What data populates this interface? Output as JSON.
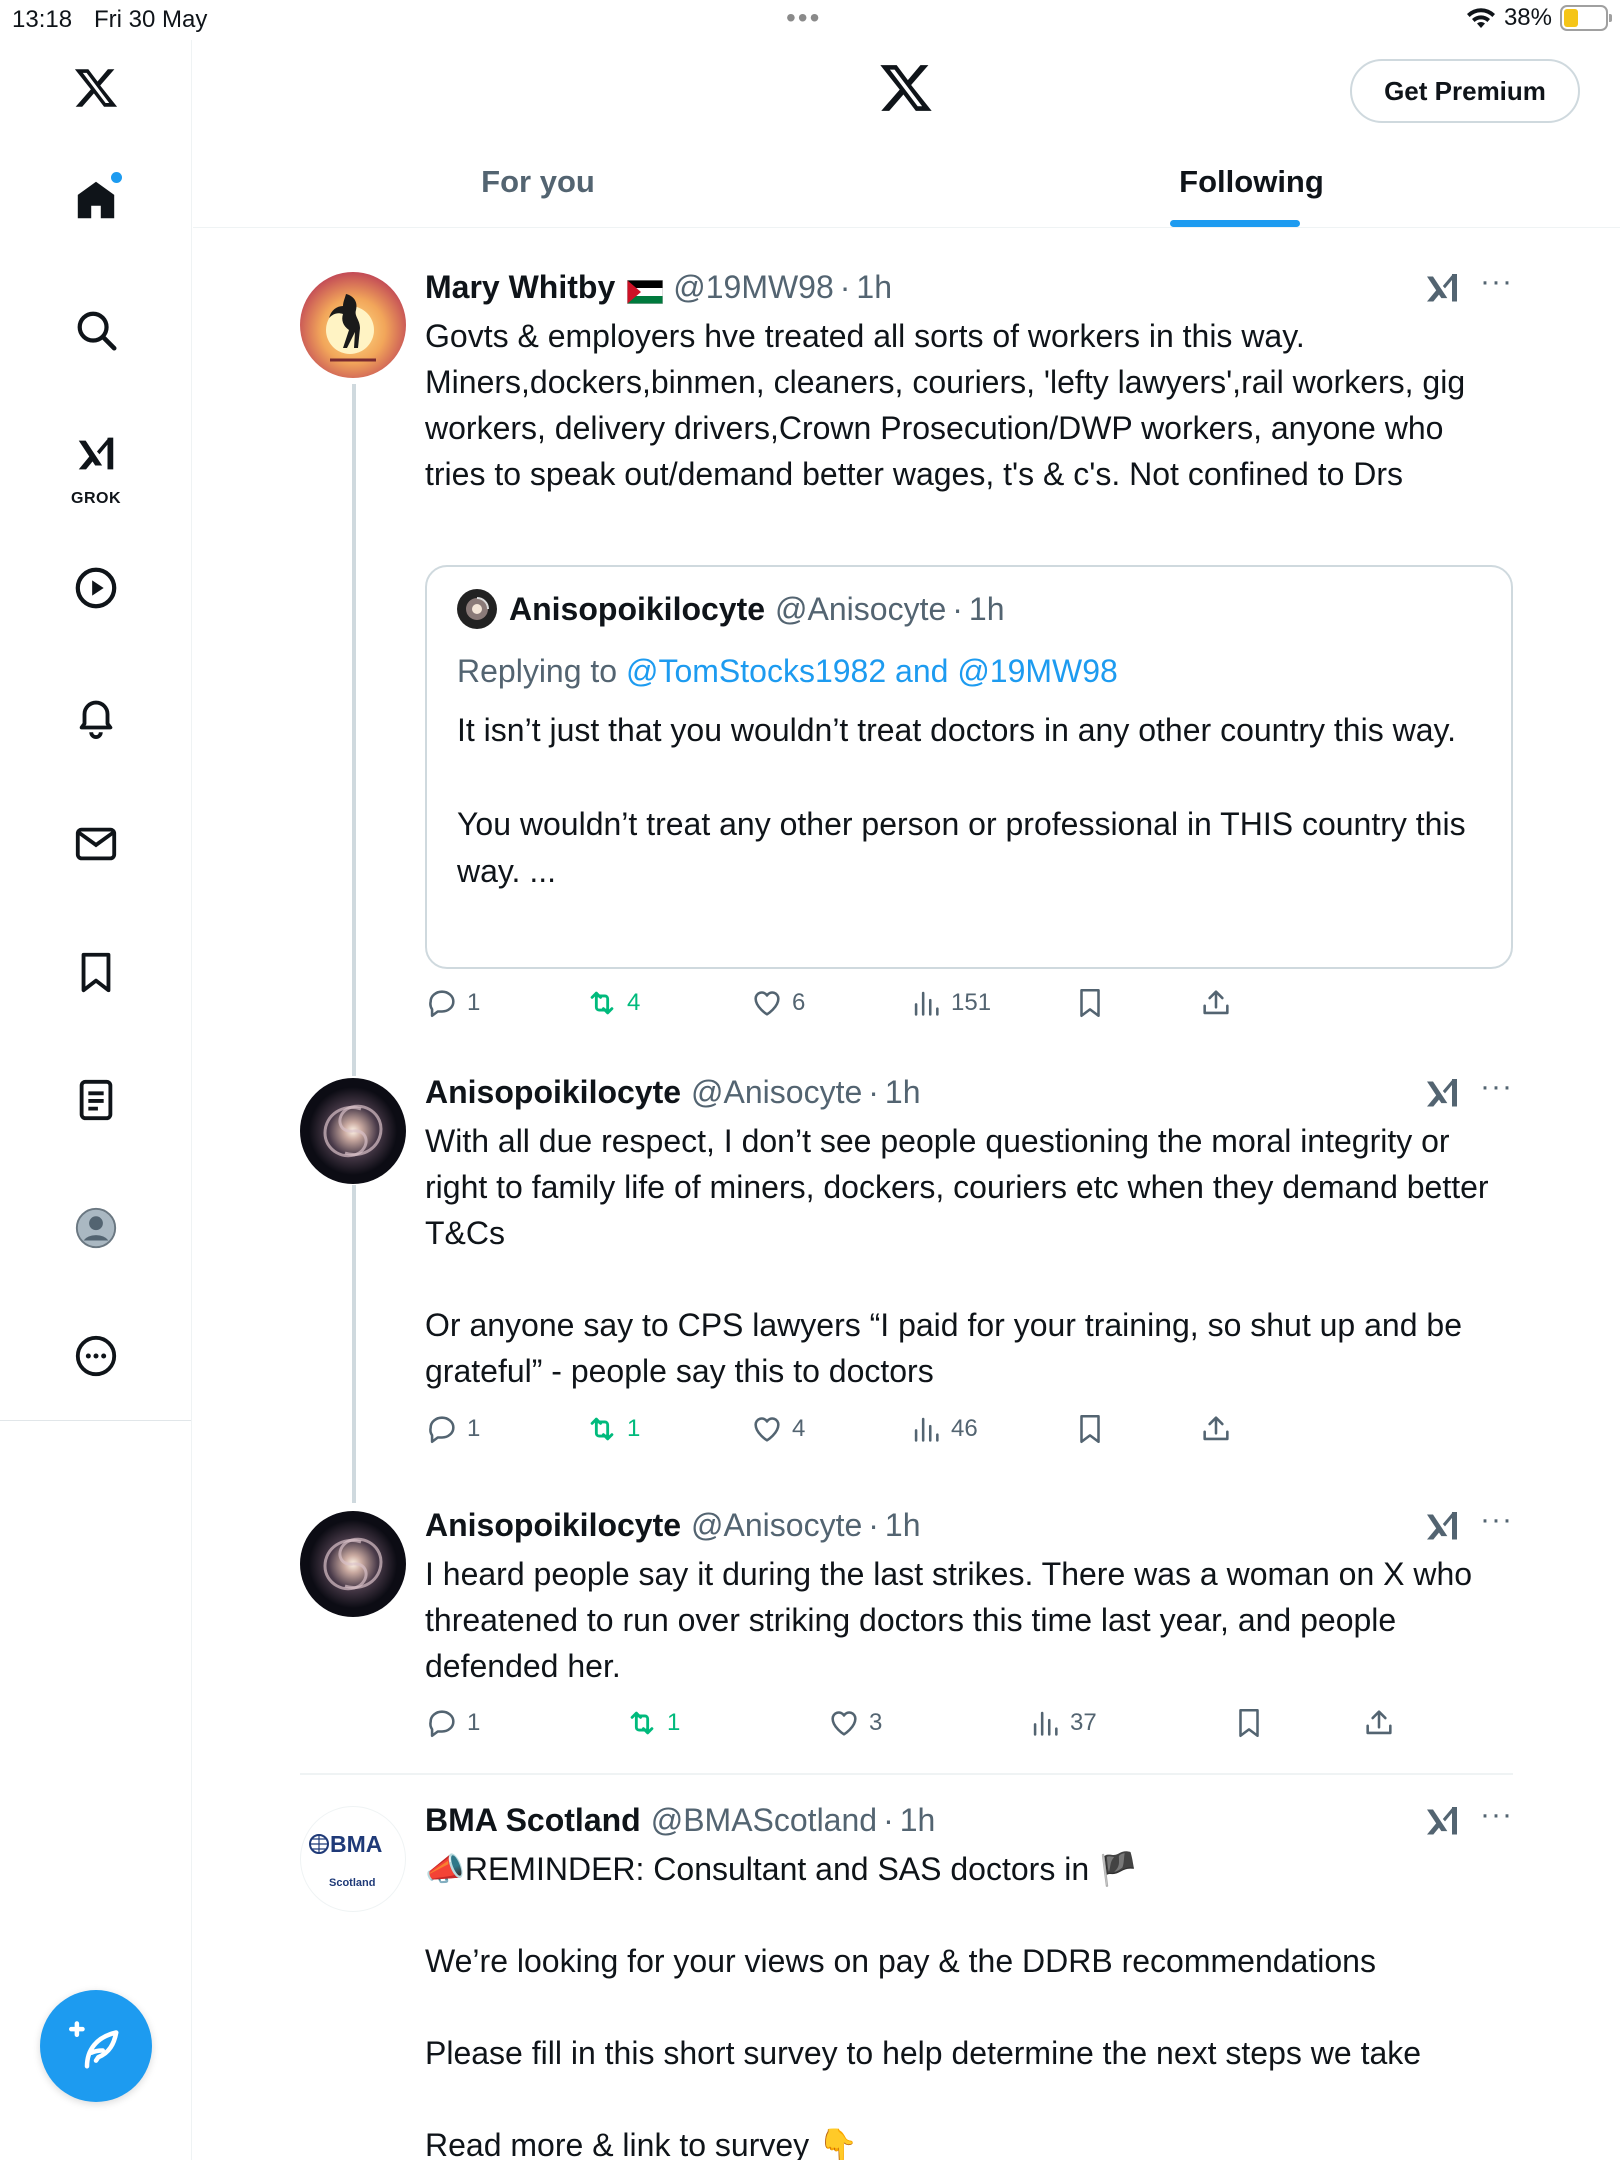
{
  "status_bar": {
    "time": "13:18",
    "date": "Fri 30 May",
    "battery": "38%"
  },
  "header": {
    "premium_button": "Get Premium",
    "tabs": [
      "For you",
      "Following"
    ],
    "active_tab": "Following"
  },
  "sidebar": {
    "grok_label": "GROK",
    "items": [
      "x-logo",
      "home-icon",
      "search-icon",
      "grok-icon",
      "video-icon",
      "bell-icon",
      "mail-icon",
      "bookmark-icon",
      "list-icon",
      "profile-icon",
      "more-icon"
    ]
  },
  "tweets": [
    {
      "name": "Mary Whitby",
      "handle": "@19MW98",
      "time": "1h",
      "text": "Govts & employers hve treated all sorts of workers in this way. Miners,dockers,binmen, cleaners, couriers, 'lefty lawyers',rail workers, gig workers, delivery drivers,Crown Prosecution/DWP workers, anyone who tries to speak out/demand better wages, t's & c's. Not confined to Drs",
      "quote": {
        "name": "Anisopoikilocyte",
        "handle": "@Anisocyte",
        "time": "1h",
        "replying_to_label": "Replying to",
        "replying_to": "@TomStocks1982 and @19MW98",
        "text": "It isn’t just that you wouldn’t treat doctors in any other country this way.\n\nYou wouldn’t treat any other person or professional in THIS country this way. ..."
      },
      "replies": "1",
      "reposts": "4",
      "likes": "6",
      "views": "151"
    },
    {
      "name": "Anisopoikilocyte",
      "handle": "@Anisocyte",
      "time": "1h",
      "text": "With all due respect, I don’t see people questioning the moral integrity or right to family life of miners, dockers, couriers etc when they demand better T&Cs\n\nOr anyone say to CPS lawyers “I paid for your training, so shut up and be grateful” - people say this to doctors",
      "replies": "1",
      "reposts": "1",
      "likes": "4",
      "views": "46"
    },
    {
      "name": "Anisopoikilocyte",
      "handle": "@Anisocyte",
      "time": "1h",
      "text": "I heard people say it during the last strikes. There was a woman on X who threatened to run over striking doctors this time last year, and people defended her.",
      "replies": "1",
      "reposts": "1",
      "likes": "3",
      "views": "37"
    },
    {
      "name": "BMA Scotland",
      "handle": "@BMAScotland",
      "time": "1h",
      "avatar_text": "BMA",
      "avatar_subtext": "Scotland",
      "text": "📣REMINDER: Consultant and SAS doctors in 🏴\n\nWe’re looking for your views on pay & the DDRB recommendations\n\nPlease fill in this short survey to help determine the next steps we take\n\nRead more & link to survey 👇"
    }
  ],
  "separator": "·",
  "more_label": "···",
  "colors": {
    "accent": "#1d9bf0",
    "repost": "#00ba7c",
    "secondary_text": "#536471",
    "border": "#cfd9de"
  }
}
